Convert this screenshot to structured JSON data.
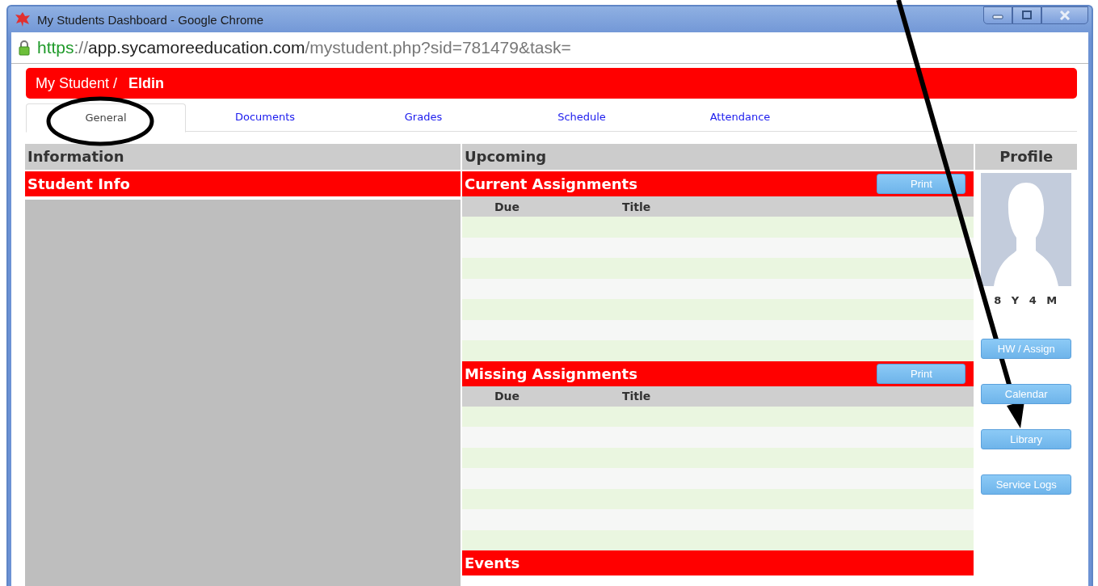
{
  "window": {
    "title": "My Students Dashboard - Google Chrome"
  },
  "address_bar": {
    "scheme": "https",
    "separator": "://",
    "host": "app.sycamoreeducation.com",
    "path": "/mystudent.php?sid=781479&task="
  },
  "breadcrumb": {
    "parent": "My Student /",
    "current": "Eldin"
  },
  "tabs": [
    {
      "label": "General",
      "selected": true
    },
    {
      "label": "Documents",
      "selected": false
    },
    {
      "label": "Grades",
      "selected": false
    },
    {
      "label": "Schedule",
      "selected": false
    },
    {
      "label": "Attendance",
      "selected": false
    }
  ],
  "information": {
    "heading": "Information",
    "section": "Student Info"
  },
  "upcoming": {
    "heading": "Upcoming",
    "sections": [
      {
        "title": "Current Assignments",
        "button": "Print",
        "columns": [
          "Due",
          "Title"
        ]
      },
      {
        "title": "Missing Assignments",
        "button": "Print",
        "columns": [
          "Due",
          "Title"
        ]
      },
      {
        "title": "Events"
      }
    ]
  },
  "profile": {
    "heading": "Profile",
    "age": "8 Y 4 M",
    "buttons": [
      "HW / Assign",
      "Calendar",
      "Library",
      "Service Logs"
    ]
  }
}
